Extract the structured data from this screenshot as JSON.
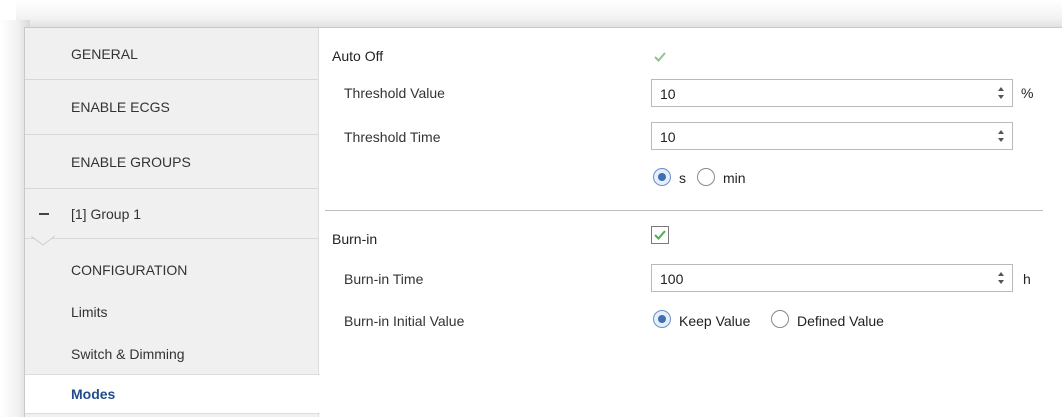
{
  "sidebar": {
    "items": [
      {
        "label": "GENERAL"
      },
      {
        "label": "ENABLE ECGS"
      },
      {
        "label": "ENABLE GROUPS"
      },
      {
        "label": "[1] Group 1"
      },
      {
        "label": "CONFIGURATION"
      },
      {
        "label": "Limits"
      },
      {
        "label": "Switch & Dimming"
      },
      {
        "label": "Modes"
      }
    ]
  },
  "auto_off": {
    "label": "Auto Off",
    "checked": true,
    "threshold_value": {
      "label": "Threshold Value",
      "value": "10",
      "unit": "%"
    },
    "threshold_time": {
      "label": "Threshold Time",
      "value": "10"
    },
    "time_unit": {
      "options": [
        "s",
        "min"
      ],
      "selected": "s"
    }
  },
  "burn_in": {
    "label": "Burn-in",
    "checked": true,
    "time": {
      "label": "Burn-in Time",
      "value": "100",
      "unit": "h"
    },
    "initial_value": {
      "label": "Burn-in Initial Value",
      "options": [
        "Keep Value",
        "Defined Value"
      ],
      "selected": "Keep Value"
    }
  },
  "colors": {
    "accent": "#1f4e8a",
    "check": "#4caf50",
    "sidebar_bg": "#f0f0f0"
  }
}
